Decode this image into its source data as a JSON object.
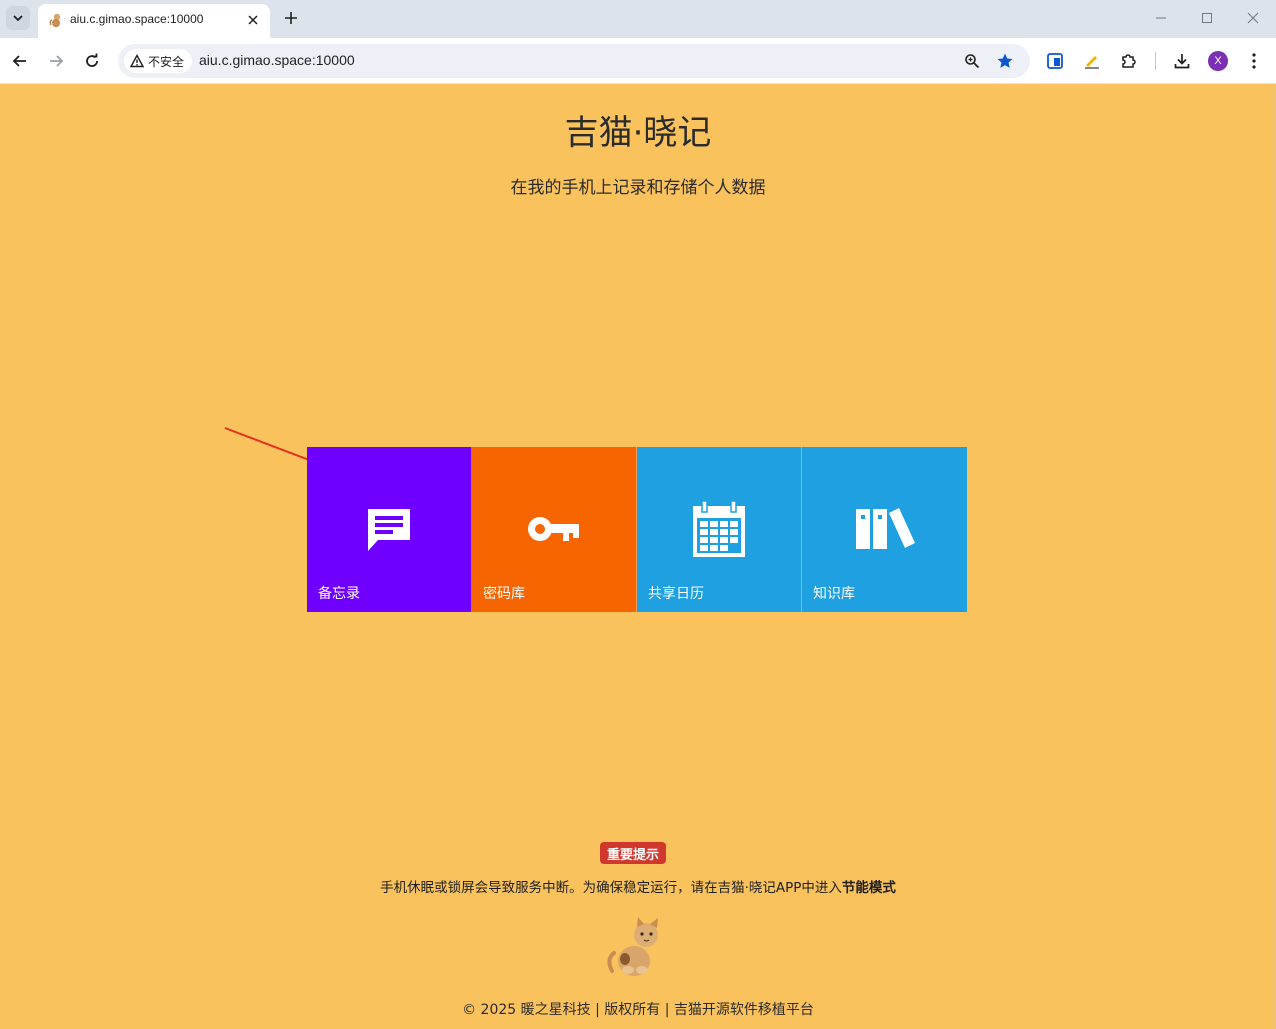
{
  "browser": {
    "tab_title": "aiu.c.gimao.space:10000",
    "insecure_label": "不安全",
    "url": "aiu.c.gimao.space:10000",
    "profile_initial": "X"
  },
  "page": {
    "title": "吉猫·晓记",
    "subtitle": "在我的手机上记录和存储个人数据",
    "tiles": [
      {
        "label": "备忘录",
        "color": "#6f00ff",
        "icon": "chat-icon"
      },
      {
        "label": "密码库",
        "color": "#f66500",
        "icon": "key-icon"
      },
      {
        "label": "共享日历",
        "color": "#1ea0e1",
        "icon": "calendar-icon"
      },
      {
        "label": "知识库",
        "color": "#1ea0e1",
        "icon": "books-icon"
      }
    ],
    "notice": {
      "badge": "重要提示",
      "text_prefix": "手机休眠或锁屏会导致服务中断。为确保稳定运行，请在吉猫·晓记APP中进入",
      "text_bold": "节能模式"
    },
    "footer": "© 2025 暖之星科技 | 版权所有 | 吉猫开源软件移植平台"
  }
}
